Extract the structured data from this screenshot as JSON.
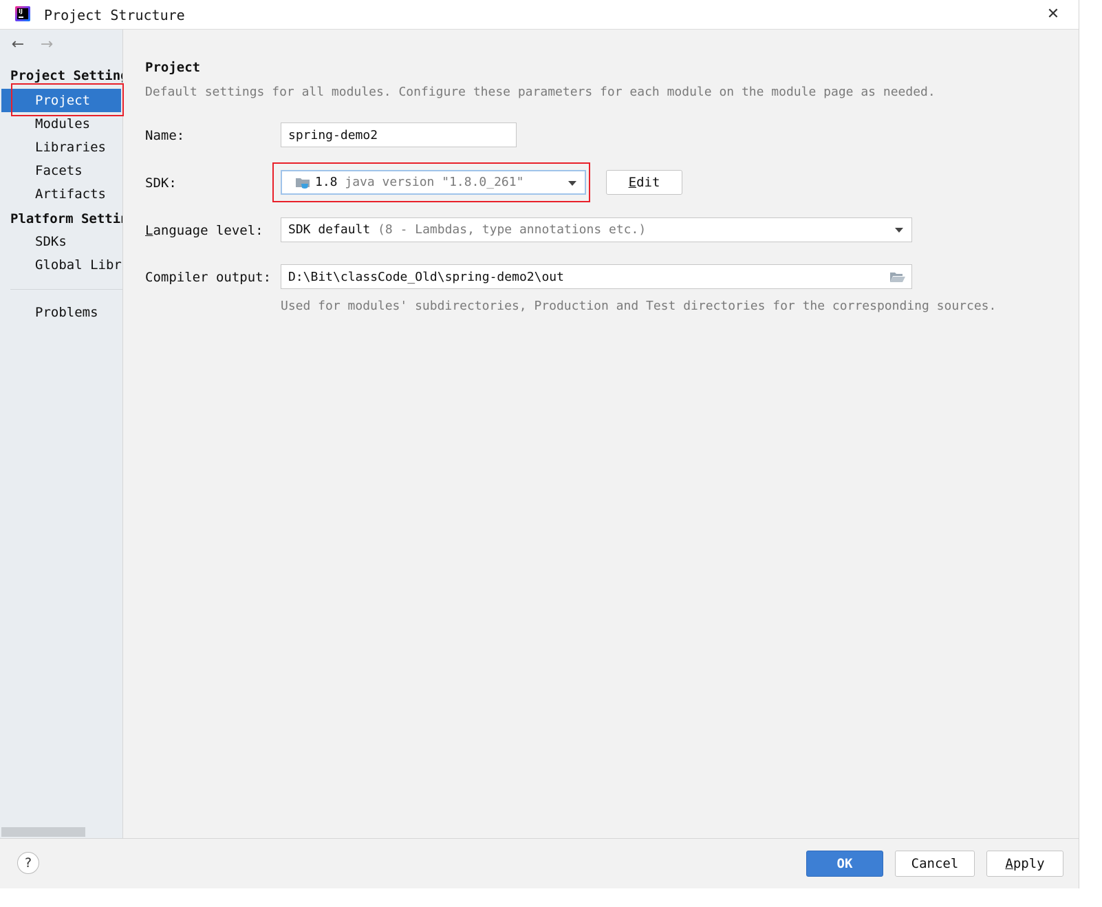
{
  "window": {
    "title": "Project Structure",
    "close_glyph": "✕"
  },
  "sidebar": {
    "back_glyph": "←",
    "forward_glyph": "→",
    "project_settings_heading": "Project Settings",
    "platform_settings_heading": "Platform Settings",
    "items": [
      {
        "label": "Project",
        "selected": true
      },
      {
        "label": "Modules"
      },
      {
        "label": "Libraries"
      },
      {
        "label": "Facets"
      },
      {
        "label": "Artifacts"
      },
      {
        "label": "SDKs"
      },
      {
        "label": "Global Libraries"
      },
      {
        "label": "Problems"
      }
    ]
  },
  "main": {
    "title": "Project",
    "description": "Default settings for all modules. Configure these parameters for each module on the module page as needed.",
    "name": {
      "label": "Name:",
      "value": "spring-demo2"
    },
    "sdk": {
      "label": "SDK:",
      "value_main": "1.8",
      "value_detail": " java version \"1.8.0_261\"",
      "edit_button": {
        "mnemonic": "E",
        "rest": "dit"
      }
    },
    "language_level": {
      "label_mnemonic": "L",
      "label_rest": "anguage level:",
      "value_main": "SDK default",
      "value_detail": " (8 - Lambdas, type annotations etc.)"
    },
    "compiler_output": {
      "label": "Compiler output:",
      "value": "D:\\Bit\\classCode_Old\\spring-demo2\\out",
      "hint": "Used for modules' subdirectories, Production and Test directories for the corresponding sources."
    }
  },
  "footer": {
    "help_glyph": "?",
    "ok_label": "OK",
    "cancel_label": "Cancel",
    "apply": {
      "mnemonic": "A",
      "rest": "pply"
    }
  },
  "colors": {
    "selection": "#2f78cc",
    "annotation_red": "#e8202a",
    "primary_button": "#3d7fd4"
  },
  "icons": {
    "app": "intellij-idea-icon",
    "sdk": "java-sdk-folder-icon",
    "browse": "open-folder-icon",
    "help": "help-icon"
  }
}
